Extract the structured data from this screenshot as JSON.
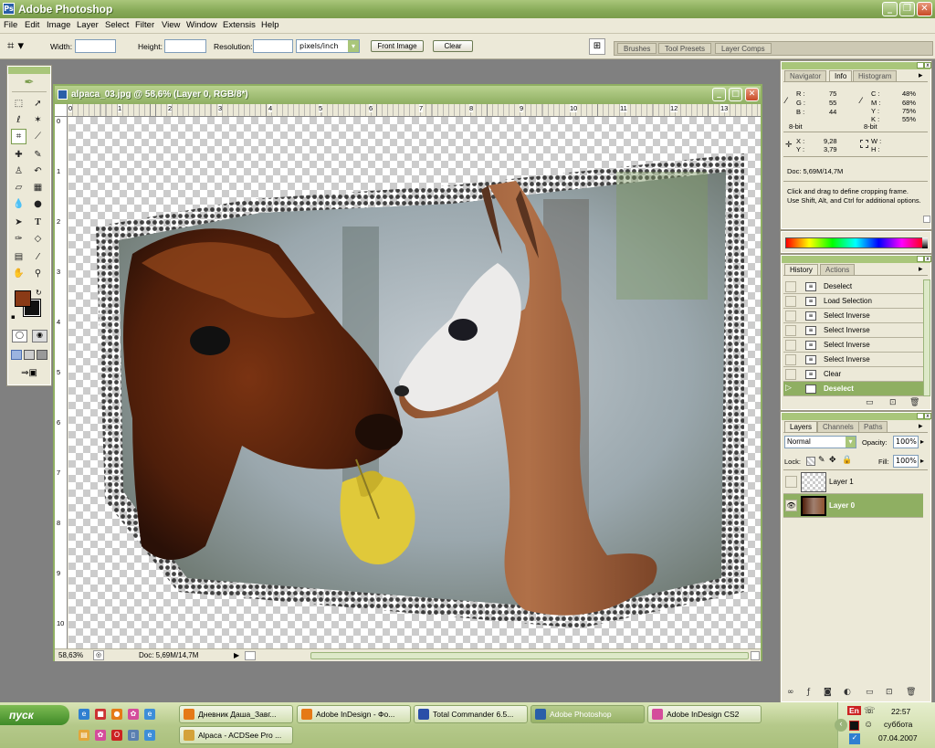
{
  "app": {
    "title": "Adobe Photoshop"
  },
  "menu": [
    "File",
    "Edit",
    "Image",
    "Layer",
    "Select",
    "Filter",
    "View",
    "Window",
    "Extensis",
    "Help"
  ],
  "options": {
    "width_label": "Width:",
    "height_label": "Height:",
    "resolution_label": "Resolution:",
    "unit_value": "pixels/inch",
    "front_image_label": "Front Image",
    "clear_label": "Clear"
  },
  "palette_well": [
    "Brushes",
    "Tool Presets",
    "Layer Comps"
  ],
  "document": {
    "title": "alpaca_03.jpg @ 58,6% (Layer 0, RGB/8*)",
    "zoom": "58,63%",
    "doc_size": "Doc: 5,69M/14,7M",
    "ruler_h": [
      "0",
      "1",
      "2",
      "3",
      "4",
      "5",
      "6",
      "7",
      "8",
      "9",
      "10",
      "11",
      "12",
      "13"
    ],
    "ruler_v": [
      "0",
      "1",
      "2",
      "3",
      "4",
      "5",
      "6",
      "7",
      "8",
      "9",
      "10"
    ]
  },
  "info_panel": {
    "tabs": [
      "Navigator",
      "Info",
      "Histogram"
    ],
    "active_tab": "Info",
    "r_label": "R :",
    "r_value": "75",
    "g_label": "G :",
    "g_value": "55",
    "b_label": "B :",
    "b_value": "44",
    "bit_left": "8-bit",
    "c_label": "C :",
    "c_value": "48%",
    "m_label": "M :",
    "m_value": "68%",
    "y_label": "Y :",
    "y_value": "75%",
    "k_label": "K :",
    "k_value": "55%",
    "bit_right": "8-bit",
    "x_label": "X :",
    "x_value": "9,28",
    "yy_label": "Y :",
    "yy_value": "3,79",
    "w_label": "W :",
    "h_label": "H :",
    "doc_size": "Doc: 5,69M/14,7M",
    "hint": "Click and drag to define cropping frame. Use Shift, Alt, and Ctrl for additional options."
  },
  "history_panel": {
    "tabs": [
      "History",
      "Actions"
    ],
    "active_tab": "History",
    "items": [
      "Deselect",
      "Load Selection",
      "Select Inverse",
      "Select Inverse",
      "Select Inverse",
      "Select Inverse",
      "Clear",
      "Deselect"
    ],
    "active_index": 7
  },
  "layers_panel": {
    "tabs": [
      "Layers",
      "Channels",
      "Paths"
    ],
    "active_tab": "Layers",
    "blend_mode": "Normal",
    "opacity_label": "Opacity:",
    "opacity_value": "100%",
    "lock_label": "Lock:",
    "fill_label": "Fill:",
    "fill_value": "100%",
    "layers": [
      "Layer 1",
      "Layer 0"
    ],
    "active_layer": "Layer 0"
  },
  "taskbar": {
    "start_label": "пуск",
    "buttons_row1": [
      "Дневник Даша_Завг...",
      "Adobe InDesign - Фо...",
      "Total Commander 6.5...",
      "Adobe Photoshop",
      "Adobe InDesign CS2"
    ],
    "buttons_row2": [
      "Alpaca - ACDSee Pro ..."
    ],
    "active_button": "Adobe Photoshop",
    "lang": "En",
    "time": "22:57",
    "day": "суббота",
    "date": "07.04.2007"
  },
  "colors": {
    "foreground": "#8a3a16",
    "background": "#111111",
    "accent": "#8faf62"
  }
}
